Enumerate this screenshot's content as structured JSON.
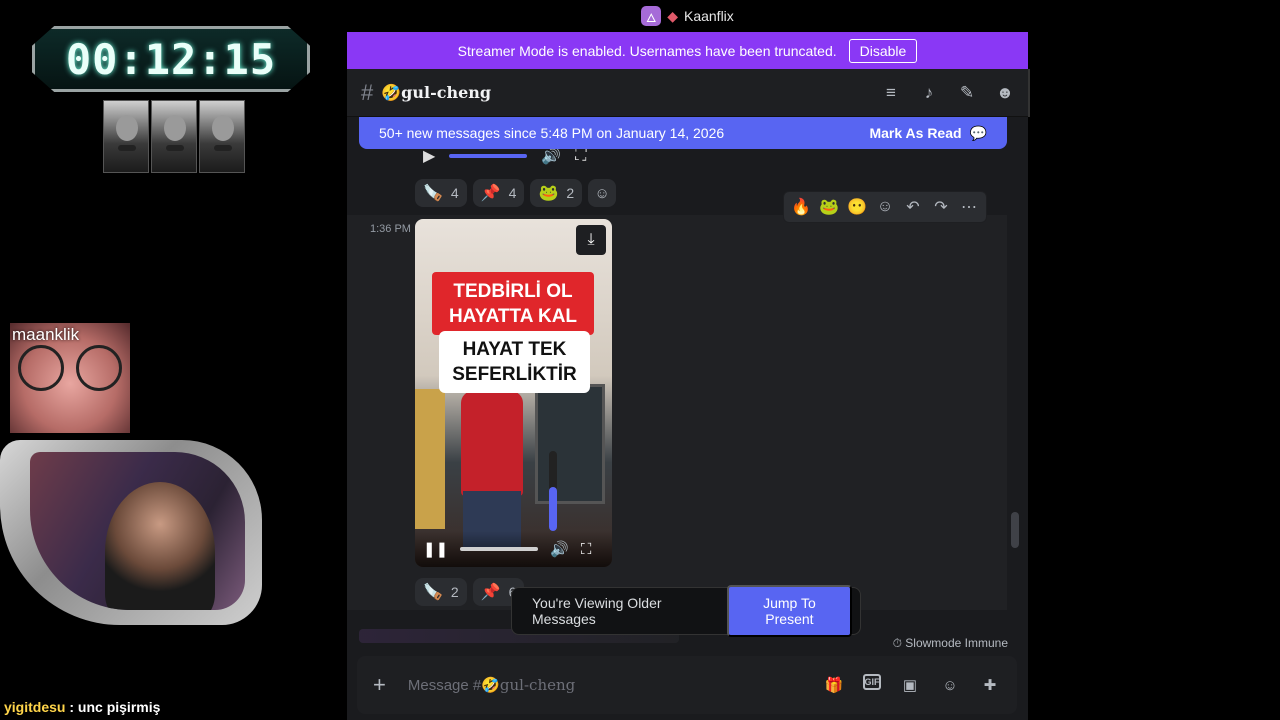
{
  "overlay": {
    "timer": "00:12:15",
    "webcam_label": "maanklik",
    "chat": {
      "user": "yigitdesu",
      "separator": " : ",
      "message": "unc pişirmiş"
    }
  },
  "window": {
    "app_icon": "🜂",
    "title": "Kaanflix"
  },
  "streamer_banner": {
    "text": "Streamer Mode is enabled. Usernames have been truncated.",
    "button": "Disable"
  },
  "channel": {
    "hash": "#",
    "emoji": "🤣",
    "name": "gul-cheng"
  },
  "header_icons": [
    "threads-icon",
    "bell-icon",
    "pin-icon",
    "members-icon"
  ],
  "new_messages": {
    "text": "50+ new messages since 5:48 PM on January 14, 2026",
    "mark_read": "Mark As Read"
  },
  "prev_reactions": [
    {
      "emoji": "🪚",
      "count": "4"
    },
    {
      "emoji": "📌",
      "count": "4"
    },
    {
      "emoji": "🐸",
      "count": "2"
    }
  ],
  "message": {
    "timestamp": "1:36 PM",
    "video": {
      "caption_red": [
        "TEDBİRLİ OL",
        "HAYATTA KAL"
      ],
      "caption_white": [
        "HAYAT TEK",
        "SEFERLİKTİR"
      ],
      "volume": 0.55
    },
    "reactions": [
      {
        "emoji": "🪚",
        "count": "2"
      },
      {
        "emoji": "📌",
        "count": "6"
      }
    ]
  },
  "toolbar_emojis": [
    "🔥",
    "🐸",
    "😶"
  ],
  "older_bar": {
    "text": "You're Viewing Older Messages",
    "button": "Jump To Present"
  },
  "slowmode": "Slowmode Immune",
  "input": {
    "placeholder_prefix": "Message #",
    "emoji": "🤣",
    "channel": "gul-cheng"
  },
  "colors": {
    "accent": "#5865f2",
    "streamer_banner": "#8a38f5"
  }
}
